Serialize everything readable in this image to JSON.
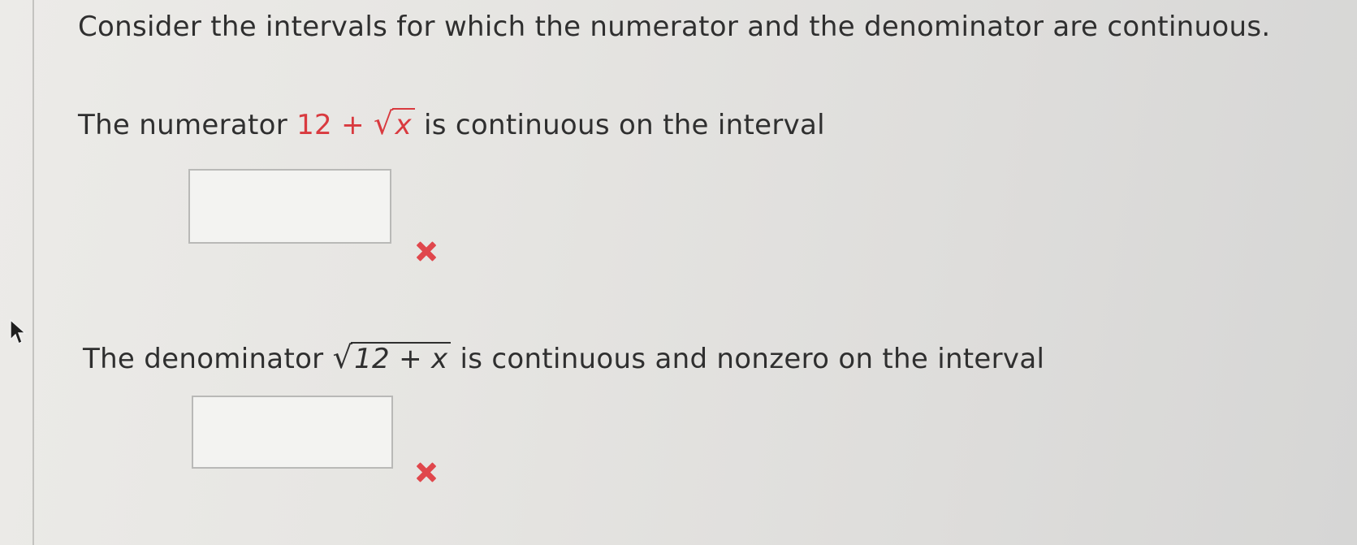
{
  "heading": "Consider the intervals for which the numerator and the denominator are continuous.",
  "numerator": {
    "prefix": "The numerator",
    "expression_base": "12 +",
    "radicand": "x",
    "suffix": "is continuous on the interval",
    "answer_value": "",
    "status_icon": "x-mark-icon",
    "status_color": "#e0474c"
  },
  "denominator": {
    "prefix": "The denominator",
    "radicand": "12 + x",
    "suffix": "is continuous and nonzero on the interval",
    "answer_value": "",
    "status_icon": "x-mark-icon",
    "status_color": "#e0474c"
  },
  "colors": {
    "math_accent": "#d93a3f",
    "text": "#2f2f2f",
    "incorrect": "#e0474c"
  }
}
